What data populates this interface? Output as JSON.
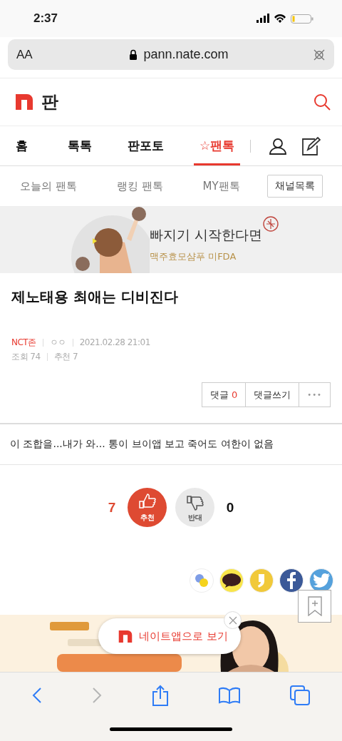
{
  "status_bar": {
    "time": "2:37"
  },
  "address_bar": {
    "text_size": "AA",
    "url": "pann.nate.com"
  },
  "header": {
    "title": "판"
  },
  "tabs": [
    {
      "label": "홈",
      "selected": false
    },
    {
      "label": "톡톡",
      "selected": false
    },
    {
      "label": "판포토",
      "selected": false
    },
    {
      "label": "☆팬톡",
      "selected": true
    }
  ],
  "subtabs": [
    "오늘의 팬톡",
    "랭킹 팬톡",
    "MY팬톡"
  ],
  "channel_button": "채널목록",
  "ad": {
    "headline": "빠지기 시작한다면",
    "subline": "맥주효모샴푸 미FDA"
  },
  "post": {
    "title": "제노태용 최애는 디비진다",
    "channel": "NCT존",
    "author": "ㅇㅇ",
    "date": "2021.02.28 21:01",
    "views": "조회 74",
    "recommends": "추천 7",
    "comment_label": "댓글",
    "comment_count": "0",
    "write_comment": "댓글쓰기",
    "more": "•••",
    "body": "이 조합을...내가 와... 통이 브이앱 보고 죽어도 여한이 없음"
  },
  "votes": [
    {
      "kind": "up",
      "count": "7",
      "label": "추천"
    },
    {
      "kind": "down",
      "count": "0",
      "label": "반대"
    }
  ],
  "share": [
    {
      "kind": "band",
      "color": "#ffffff"
    },
    {
      "kind": "kakaotalk",
      "color": "#f9e54a"
    },
    {
      "kind": "kakaostory",
      "color": "#f1c93a"
    },
    {
      "kind": "facebook",
      "color": "#3b5998"
    },
    {
      "kind": "twitter",
      "color": "#55a1dc"
    }
  ],
  "bottom_ad": {
    "kind": "picture"
  },
  "app_popup": {
    "label": "네이트앱으로 보기"
  }
}
